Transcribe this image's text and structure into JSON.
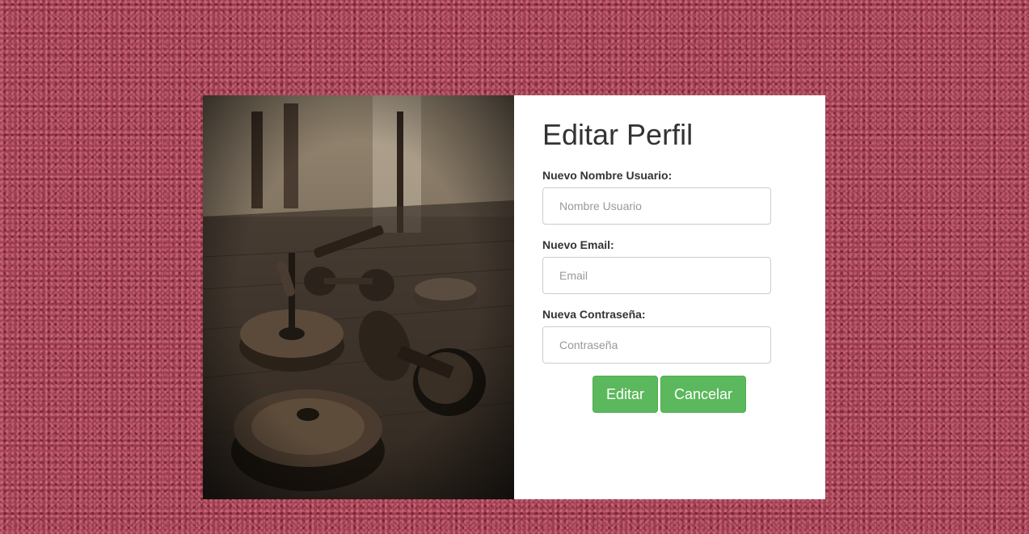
{
  "form": {
    "title": "Editar Perfil",
    "username_label": "Nuevo Nombre Usuario:",
    "username_placeholder": "Nombre Usuario",
    "username_value": "",
    "email_label": "Nuevo Email:",
    "email_placeholder": "Email",
    "email_value": "",
    "password_label": "Nueva Contraseña:",
    "password_placeholder": "Contraseña",
    "password_value": "",
    "edit_button": "Editar",
    "cancel_button": "Cancelar"
  },
  "colors": {
    "background": "#9e3d4f",
    "button": "#5cb85c",
    "text": "#333333"
  }
}
